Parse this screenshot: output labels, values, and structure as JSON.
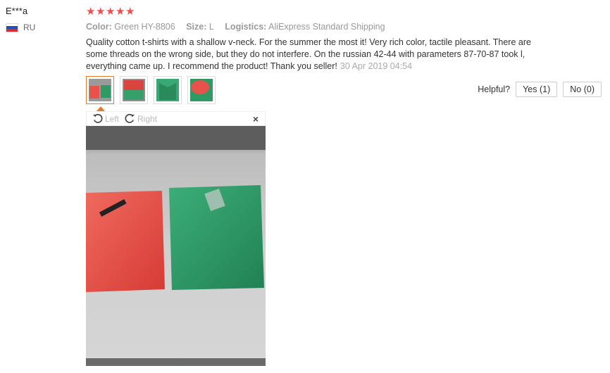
{
  "reviewer": {
    "name": "E***a",
    "country_code": "RU"
  },
  "rating": {
    "stars": 5
  },
  "meta": {
    "color_label": "Color:",
    "color_value": "Green HY-8806",
    "size_label": "Size:",
    "size_value": "L",
    "logistics_label": "Logistics:",
    "logistics_value": "AliExpress Standard Shipping"
  },
  "review": {
    "text": "Quality cotton t-shirts with a shallow v-neck. For the summer the most it! Very rich color, tactile pleasant. There are some threads on the wrong side, but they do not interfere. On the russian 42-44 with parameters 87-70-87 took l, everything came up. I recommend the product! Thank you seller!",
    "date": "30 Apr 2019 04:54"
  },
  "photos": [
    {
      "icon": "photo-thumbnail-red-green-shirts",
      "active": true
    },
    {
      "icon": "photo-thumbnail-red-green-flat"
    },
    {
      "icon": "photo-thumbnail-green-shirt"
    },
    {
      "icon": "photo-thumbnail-red-green-pile"
    }
  ],
  "viewer": {
    "rotate_left_label": "Left",
    "rotate_right_label": "Right",
    "close_icon": "×"
  },
  "helpful": {
    "label": "Helpful?",
    "yes_label": "Yes (1)",
    "no_label": "No (0)"
  },
  "colors": {
    "star": "#f04e4e",
    "active_border": "#e57c2d",
    "red_shirt": "#e8524a",
    "green_shirt": "#2f9a63"
  }
}
